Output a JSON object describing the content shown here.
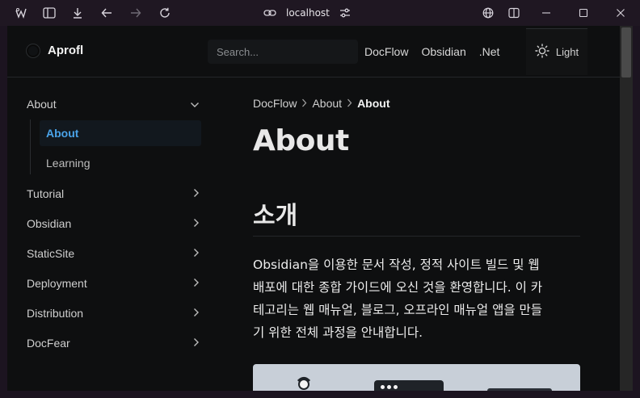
{
  "browser": {
    "address": "localhost"
  },
  "header": {
    "logo_text": "Aprofl",
    "search_placeholder": "Search...",
    "nav": [
      "DocFlow",
      "Obsidian",
      ".Net"
    ],
    "theme_label": "Light"
  },
  "sidebar": {
    "group": {
      "label": "About",
      "expanded": true
    },
    "subitems": [
      {
        "label": "About",
        "active": true
      },
      {
        "label": "Learning",
        "active": false
      }
    ],
    "items": [
      {
        "label": "Tutorial"
      },
      {
        "label": "Obsidian"
      },
      {
        "label": "StaticSite"
      },
      {
        "label": "Deployment"
      },
      {
        "label": "Distribution"
      },
      {
        "label": "DocFear"
      }
    ]
  },
  "content": {
    "breadcrumb": [
      "DocFlow",
      "About",
      "About"
    ],
    "title": "About",
    "section_title": "소개",
    "paragraph_lines": [
      "Obsidian을 이용한 문서 작성, 정적 사이트 빌드 및 웹",
      "배포에 대한 종합 가이드에 오신 것을 환영합니다. 이 카",
      "테고리는 웹 매뉴얼, 블로그, 오프라인 매뉴얼 앱을 만들",
      "기 위한 전체 과정을 안내합니다."
    ]
  },
  "colors": {
    "page_bg": "#0e0f10",
    "accent": "#4aa3e8",
    "active_bg": "#12181e"
  }
}
